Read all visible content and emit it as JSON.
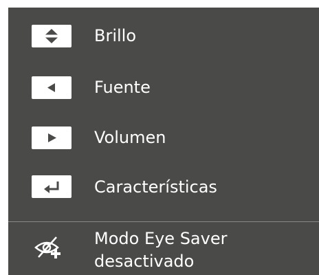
{
  "menu": {
    "items": [
      {
        "label": "Brillo",
        "icon": "up-down-arrows-icon"
      },
      {
        "label": "Fuente",
        "icon": "left-arrow-icon"
      },
      {
        "label": "Volumen",
        "icon": "right-arrow-icon"
      },
      {
        "label": "Características",
        "icon": "enter-return-icon"
      }
    ]
  },
  "status": {
    "line1": "Modo Eye Saver",
    "line2": "desactivado",
    "icon": "eye-saver-off-icon"
  },
  "colors": {
    "panel_background": "#4a4a48",
    "key_background": "#ffffff",
    "glyph": "#4a4a48",
    "text": "#ffffff",
    "divider": "#8a8a88"
  }
}
